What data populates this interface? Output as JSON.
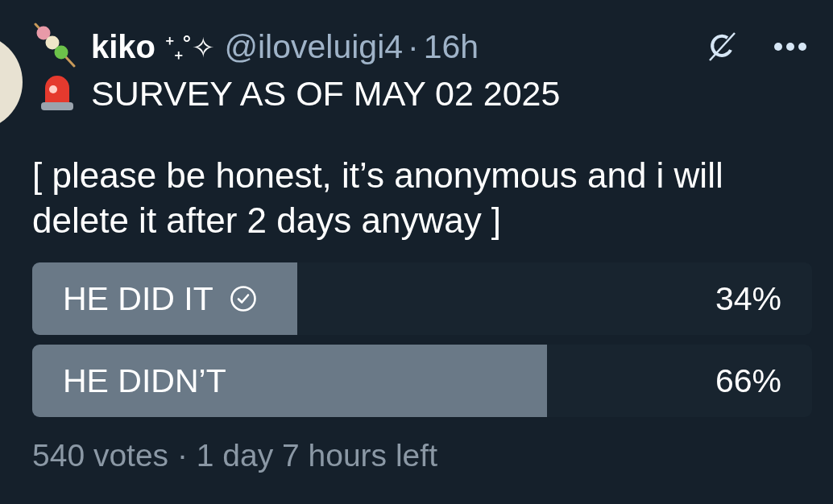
{
  "author": {
    "name": "kiko",
    "name_decoration": "⁺₊˚✧",
    "handle": "@iloveluigi4",
    "separator": "·",
    "time": "16h"
  },
  "post": {
    "title": "SURVEY AS OF MAY 02 2025",
    "text": "[ please be honest, it’s anonymous and i will delete it after 2 days anyway ]"
  },
  "poll": {
    "options": [
      {
        "label": "HE DID IT",
        "selected": true,
        "level": 0.34,
        "percent": "34%"
      },
      {
        "label": "HE DIDN’T",
        "selected": false,
        "level": 0.66,
        "percent": "66%"
      }
    ],
    "footer": "540 votes · 1 day 7 hours left"
  }
}
